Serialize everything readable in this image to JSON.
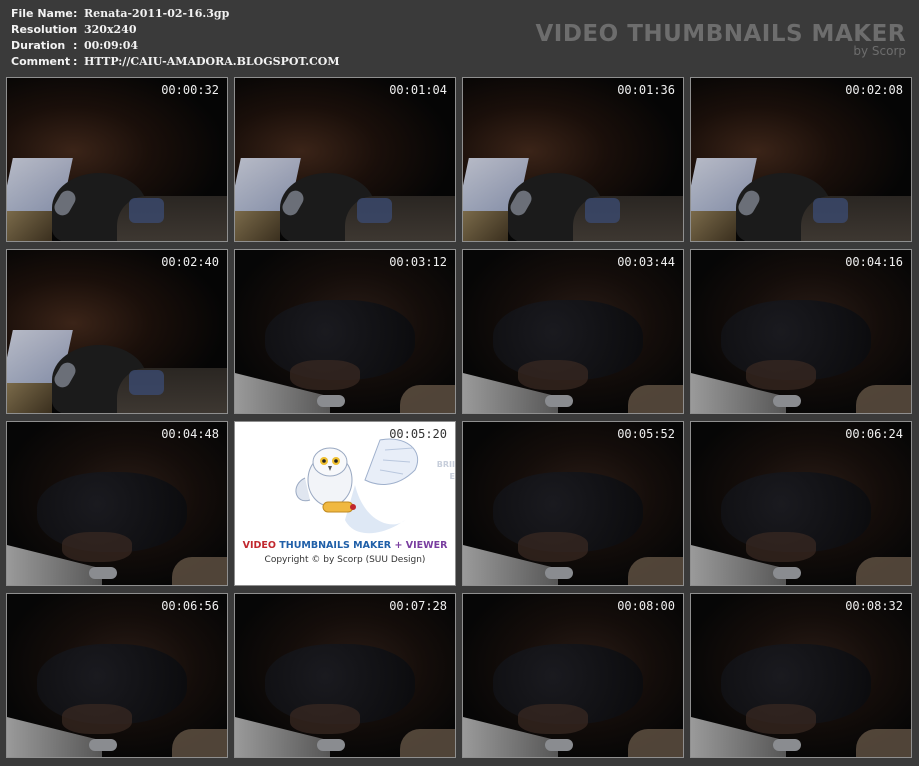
{
  "meta": [
    {
      "key": "File Name",
      "sep": ":",
      "value": "Renata-2011-02-16.3gp"
    },
    {
      "key": "Resolution",
      "sep": ":",
      "value": "320x240"
    },
    {
      "key": "Duration",
      "sep": ":",
      "value": "00:09:04"
    },
    {
      "key": "Comment",
      "sep": ":",
      "value": "HTTP://CAIU-AMADORA.BLOGSPOT.COM"
    }
  ],
  "brand": {
    "title": "VIDEO THUMBNAILS MAKER",
    "subtitle": "by Scorp"
  },
  "thumbnails": [
    {
      "time": "00:00:32",
      "scene": "A"
    },
    {
      "time": "00:01:04",
      "scene": "A"
    },
    {
      "time": "00:01:36",
      "scene": "A"
    },
    {
      "time": "00:02:08",
      "scene": "A"
    },
    {
      "time": "00:02:40",
      "scene": "A"
    },
    {
      "time": "00:03:12",
      "scene": "B"
    },
    {
      "time": "00:03:44",
      "scene": "B"
    },
    {
      "time": "00:04:16",
      "scene": "B"
    },
    {
      "time": "00:04:48",
      "scene": "B"
    },
    {
      "time": "00:05:20",
      "scene": "logo"
    },
    {
      "time": "00:05:52",
      "scene": "B"
    },
    {
      "time": "00:06:24",
      "scene": "B"
    },
    {
      "time": "00:06:56",
      "scene": "B"
    },
    {
      "time": "00:07:28",
      "scene": "B"
    },
    {
      "time": "00:08:00",
      "scene": "B"
    },
    {
      "time": "00:08:32",
      "scene": "B"
    }
  ],
  "logo": {
    "word_video": "VIDEO",
    "word_thumbnails": "THUMBNAILS MAKER",
    "word_plus": "+",
    "word_viewer": "VIEWER",
    "copyright": "Copyright © by Scorp (SUU Design)",
    "side_text_1": "BRII",
    "side_text_2": "E"
  },
  "colors": {
    "background": "#3a3a3a",
    "meta_text": "#f2f2f2",
    "brand_text": "#6d6d6d",
    "thumb_border": "#8f8f8f"
  }
}
